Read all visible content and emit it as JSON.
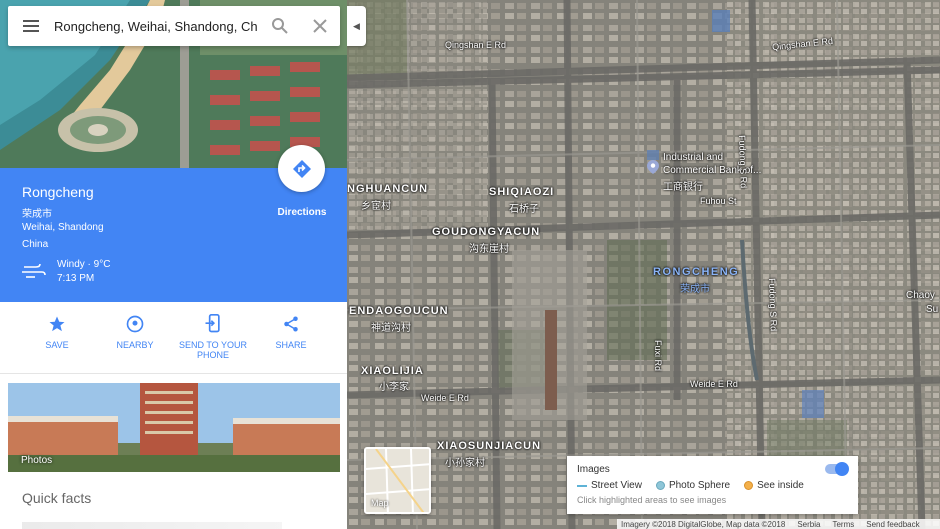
{
  "search": {
    "value": "Rongcheng, Weihai, Shandong, Ch"
  },
  "place": {
    "name": "Rongcheng",
    "name_cn": "荣成市",
    "region": "Weihai, Shandong",
    "country": "China",
    "weather": "Windy · 9°C",
    "time": "7:13 PM",
    "directions_label": "Directions"
  },
  "actions": [
    {
      "label": "SAVE",
      "icon": "star-icon"
    },
    {
      "label": "NEARBY",
      "icon": "nearby-icon"
    },
    {
      "label": "SEND TO YOUR PHONE",
      "icon": "send-to-phone-icon"
    },
    {
      "label": "SHARE",
      "icon": "share-icon"
    }
  ],
  "photos_label": "Photos",
  "quick_facts": "Quick facts",
  "map": {
    "labels": {
      "qingshan_w": "Qingshan E Rd",
      "qingshan_e": "Qingshan E Rd",
      "bank_1": "Industrial and",
      "bank_2": "Commercial Bank of...",
      "bank_cn": "工商银行",
      "fuhou": "Fuhou St",
      "fudong_n": "Fudong S Rd",
      "fudong_s": "Fudong S Rd",
      "huancun": "NGHUANCUN",
      "huancun_cn": "乡宦村",
      "shiqiaozi": "SHIQIAOZI",
      "shiqiaozi_cn": "石桥子",
      "goudong": "GOUDONGYACUN",
      "goudong_cn": "沟东崖村",
      "rongcheng": "RONGCHENG",
      "rongcheng_cn": "荣成市",
      "chaoy": "Chaoy",
      "chaoy_2": "Su",
      "endao": "ENDAOGOUCUN",
      "endao_cn": "神道沟村",
      "xiaolijia": "XIAOLIJIA",
      "xiaolijia_cn": "小李家",
      "fuxi": "Fuxi Rd",
      "weide_e": "Weide E Rd",
      "weide_w": "Weide E Rd",
      "xiaosun": "XIAOSUNJIACUN",
      "xiaosun_cn": "小孙家村"
    },
    "minimap_label": "Map",
    "images_panel": {
      "title": "Images",
      "street_view": "Street View",
      "photo_sphere": "Photo Sphere",
      "see_inside": "See inside",
      "hint": "Click highlighted areas to see images"
    },
    "attribution": {
      "imagery": "Imagery ©2018 DigitalGlobe, Map data ©2018",
      "serbia": "Serbia",
      "terms": "Terms",
      "feedback": "Send feedback"
    }
  },
  "colors": {
    "accent": "#4285f4",
    "street_view": "#5fb3d6",
    "photo_sphere": "#8ec6d8",
    "see_inside": "#f4b04a"
  }
}
